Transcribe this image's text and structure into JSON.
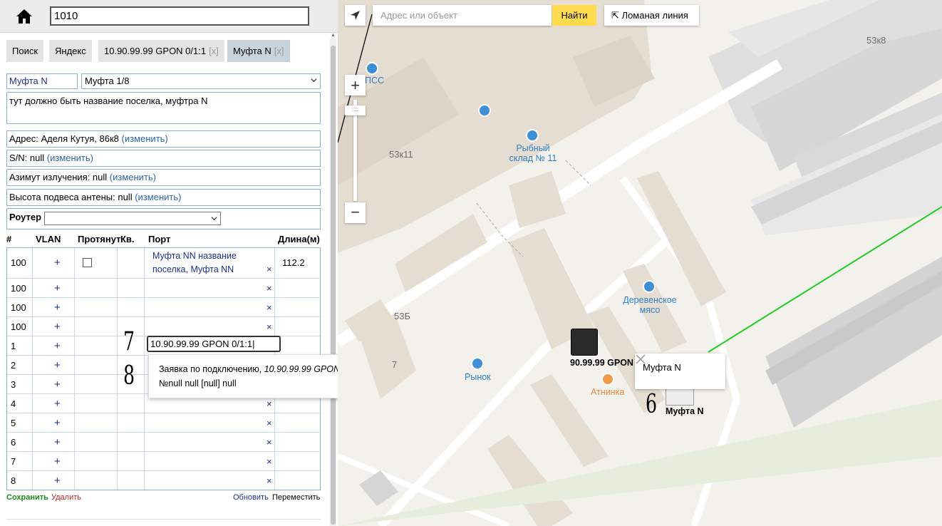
{
  "search": {
    "value": "1010"
  },
  "tabs": [
    {
      "label": "Поиск"
    },
    {
      "label": "Яндекс"
    },
    {
      "label": "10.90.99.99 GPON 0/1:1",
      "close": "[x]"
    },
    {
      "label": "Муфта N",
      "close": "[x]"
    }
  ],
  "form": {
    "name": "Муфта N",
    "type_selected": "Муфта 1/8",
    "description": "тут должно быть название поселка, муфтра N",
    "address_label": "Адрес: Аделя Кутуя, 86к8",
    "sn_label": "S/N: null",
    "azimuth_label": "Азимут излучения: null",
    "height_label": "Высота подвеса антены: null",
    "change_link": "(изменить)",
    "router_label": "Роутер",
    "router_value": ""
  },
  "table": {
    "headers": {
      "num": "#",
      "vlan": "VLAN",
      "pulled": "Протянут",
      "kv": "Кв.",
      "port": "Порт",
      "length": "Длина(м)"
    },
    "plus": "+",
    "x": "×",
    "rows": [
      {
        "num": "100",
        "port": "Муфта NN название поселка, Муфта NN",
        "length": "112.2"
      },
      {
        "num": "100"
      },
      {
        "num": "100"
      },
      {
        "num": "100"
      },
      {
        "num": "1"
      },
      {
        "num": "2"
      },
      {
        "num": "3"
      },
      {
        "num": "4"
      },
      {
        "num": "5"
      },
      {
        "num": "6"
      },
      {
        "num": "7"
      },
      {
        "num": "8"
      }
    ],
    "port_input_value": "10.90.99.99 GPON 0/1:1"
  },
  "suggestion": {
    "prefix": "Заявка по подключению,",
    "italic": "10.90.99.99 GPON 0/1:1",
    "line2": "№null null [null] null"
  },
  "handwritten": {
    "n7": "7",
    "n8": "8",
    "n6": "6"
  },
  "actions": {
    "save": "Сохранить",
    "delete": "Удалить",
    "refresh": "Обновить",
    "move": "Переместить"
  },
  "map": {
    "search_placeholder": "Адрес или объект",
    "find": "Найти",
    "polyline": "Ломаная линия",
    "zoom_in": "+",
    "zoom_out": "−",
    "zoom_handle": "::::",
    "building_labels": {
      "b53k8": "53к8",
      "b53k11": "53к11",
      "b53b": "53Б",
      "b7": "7"
    },
    "poi": {
      "pss": "ПСС",
      "fish": "Рыбный склад № 11",
      "village": "Деревенское мясо",
      "market": "Рынок",
      "atninka": "Атнинка"
    },
    "gpon_label": "90.99.99 GPON",
    "mufta_label": "Муфта N",
    "popup_text": "Муфта N"
  },
  "colors": {
    "accent_link": "#2d63a8",
    "find_button": "#ffdb4d",
    "route_line": "#22cc22"
  }
}
